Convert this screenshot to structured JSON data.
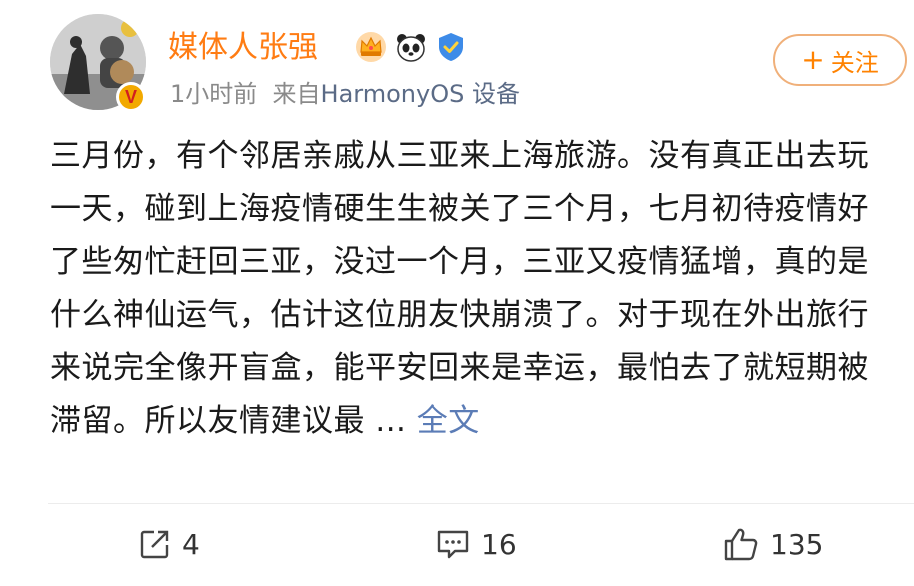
{
  "post": {
    "author": {
      "name": "媒体人张强",
      "verified_mark": "V"
    },
    "badges": [
      "crown-badge-icon",
      "panda-badge-icon",
      "shield-badge-icon"
    ],
    "time": "1小时前",
    "source_prefix": "来自",
    "source": "HarmonyOS 设备",
    "follow_label": "关注",
    "follow_plus": "+",
    "text": "三月份，有个邻居亲戚从三亚来上海旅游。没有真正出去玩一天，碰到上海疫情硬生生被关了三个月，七月初待疫情好了些匆忙赶回三亚，没过一个月，三亚又疫情猛增，真的是什么神仙运气，估计这位朋友快崩溃了。对于现在外出旅行来说完全像开盲盒，能平安回来是幸运，最怕去了就短期被滞留。所以友情建议最 ...",
    "more_label": "全文"
  },
  "actions": {
    "repost_count": "4",
    "comment_count": "16",
    "like_count": "135"
  },
  "colors": {
    "username": "#ff7c13",
    "link": "#5b7cb6",
    "follow": "#ff8200"
  }
}
